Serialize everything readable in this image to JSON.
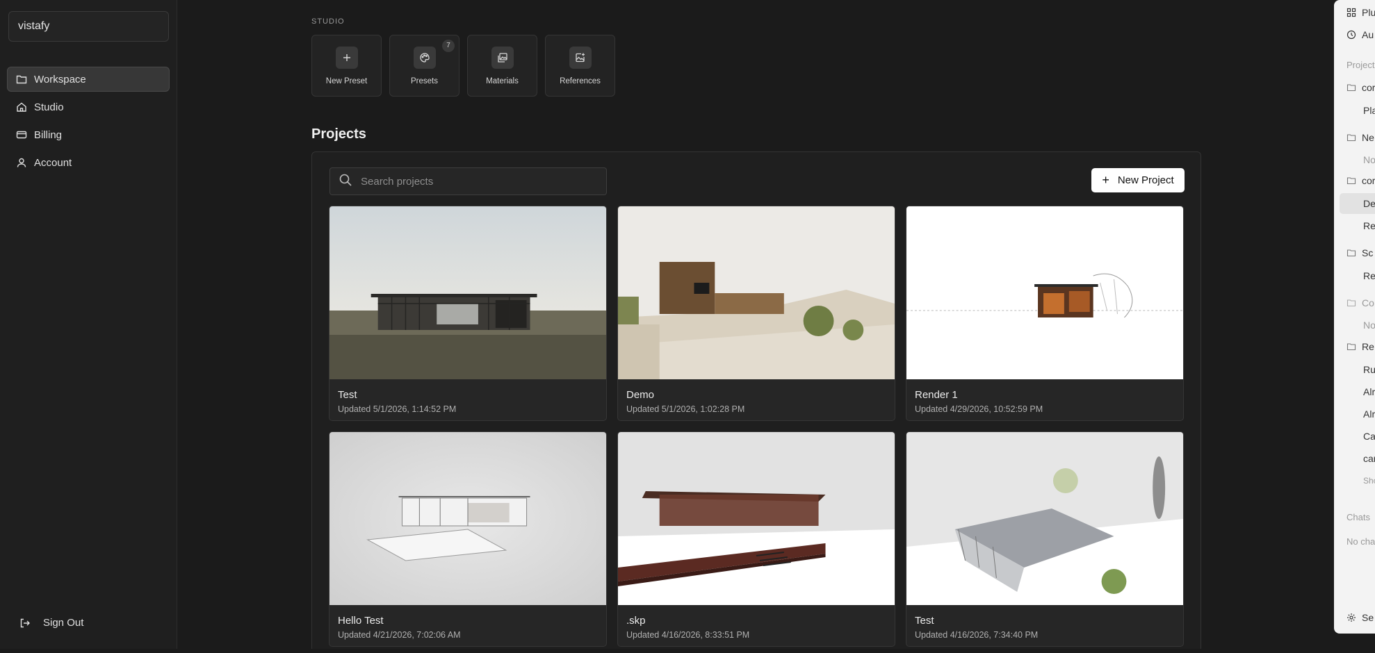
{
  "sidebar": {
    "brand": "vistafy",
    "items": [
      {
        "label": "Workspace",
        "icon": "folder-icon",
        "active": true
      },
      {
        "label": "Studio",
        "icon": "home-icon"
      },
      {
        "label": "Billing",
        "icon": "card-icon"
      },
      {
        "label": "Account",
        "icon": "user-icon"
      }
    ],
    "sign_out": "Sign Out"
  },
  "studio": {
    "label": "STUDIO",
    "tiles": [
      {
        "label": "New Preset",
        "icon": "plus-icon"
      },
      {
        "label": "Presets",
        "icon": "palette-icon",
        "badge": "7"
      },
      {
        "label": "Materials",
        "icon": "images-icon"
      },
      {
        "label": "References",
        "icon": "image-plus-icon"
      }
    ]
  },
  "projects": {
    "title": "Projects",
    "search_placeholder": "Search projects",
    "new_button": "New Project",
    "items": [
      {
        "name": "Test",
        "updated": "Updated 5/1/2026, 1:14:52 PM"
      },
      {
        "name": "Demo",
        "updated": "Updated 5/1/2026, 1:02:28 PM"
      },
      {
        "name": "Render 1",
        "updated": "Updated 4/29/2026, 10:52:59 PM"
      },
      {
        "name": "Hello Test",
        "updated": "Updated 4/21/2026, 7:02:06 AM"
      },
      {
        "name": ".skp",
        "updated": "Updated 4/16/2026, 8:33:51 PM"
      },
      {
        "name": "Test",
        "updated": "Updated 4/16/2026, 7:34:40 PM"
      }
    ]
  },
  "right_panel": {
    "rows": [
      {
        "text": "Plu",
        "icon": "grid-icon"
      },
      {
        "text": "Au",
        "icon": "clock-icon"
      },
      {
        "text": "Project",
        "muted": true
      },
      {
        "text": "cor",
        "icon": "folder-open-icon"
      },
      {
        "text": "Pla"
      },
      {
        "text": "Ne",
        "icon": "folder-open-icon"
      },
      {
        "text": "No",
        "muted": true
      },
      {
        "text": "cor",
        "icon": "folder-open-icon"
      },
      {
        "text": "De",
        "highlight": true
      },
      {
        "text": "Re"
      },
      {
        "text": "Sc",
        "icon": "folder-open-icon"
      },
      {
        "text": "Re"
      },
      {
        "text": "Co",
        "icon": "folder-open-icon",
        "muted": true
      },
      {
        "text": "No",
        "muted": true
      },
      {
        "text": "Re",
        "icon": "folder-open-icon"
      },
      {
        "text": "Ru"
      },
      {
        "text": "Alr"
      },
      {
        "text": "Alr"
      },
      {
        "text": "Ca"
      },
      {
        "text": "car"
      },
      {
        "text": "Sho",
        "muted": true
      },
      {
        "text": "Chats",
        "muted": true
      },
      {
        "text": "No cha",
        "muted": true
      },
      {
        "text": "Se",
        "icon": "gear-icon"
      }
    ]
  }
}
